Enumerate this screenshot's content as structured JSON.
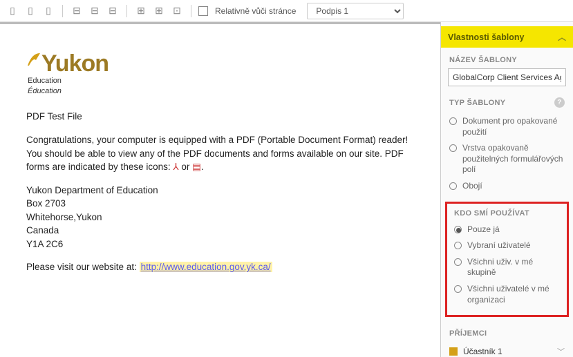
{
  "toolbar": {
    "relative_label": "Relativně vůči stránce",
    "select_value": "Podpis 1"
  },
  "document": {
    "logo_text": "Yukon",
    "logo_sub1": "Education",
    "logo_sub2": "Éducation",
    "title": "PDF Test File",
    "para1a": "Congratulations, your computer is equipped with a PDF (Portable Document Format) reader!  You should be able to view any of the PDF documents and forms available on our site.  PDF forms are indicated by these icons: ",
    "para1_or": "  or  ",
    "addr1": "Yukon Department of Education",
    "addr2": "Box 2703",
    "addr3": "Whitehorse,Yukon",
    "addr4": "Canada",
    "addr5": "Y1A 2C6",
    "visit": "Please visit our website at:  ",
    "url": "http://www.education.gov.yk.ca/"
  },
  "sidebar": {
    "panel_title": "Vlastnosti šablony",
    "name_title": "NÁZEV ŠABLONY",
    "name_value": "GlobalCorp Client Services Agreement",
    "type_title": "TYP ŠABLONY",
    "type_options": [
      "Dokument pro opakované použití",
      "Vrstva opakovaně použitelných formulářových polí",
      "Obojí"
    ],
    "who_title": "KDO SMÍ POUŽÍVAT",
    "who_options": [
      "Pouze já",
      "Vybraní uživatelé",
      "Všichni uživ. v mé skupině",
      "Všichni uživatelé v mé organizaci"
    ],
    "recipients_title": "PŘÍJEMCI",
    "recipient1": "Účastník 1"
  }
}
